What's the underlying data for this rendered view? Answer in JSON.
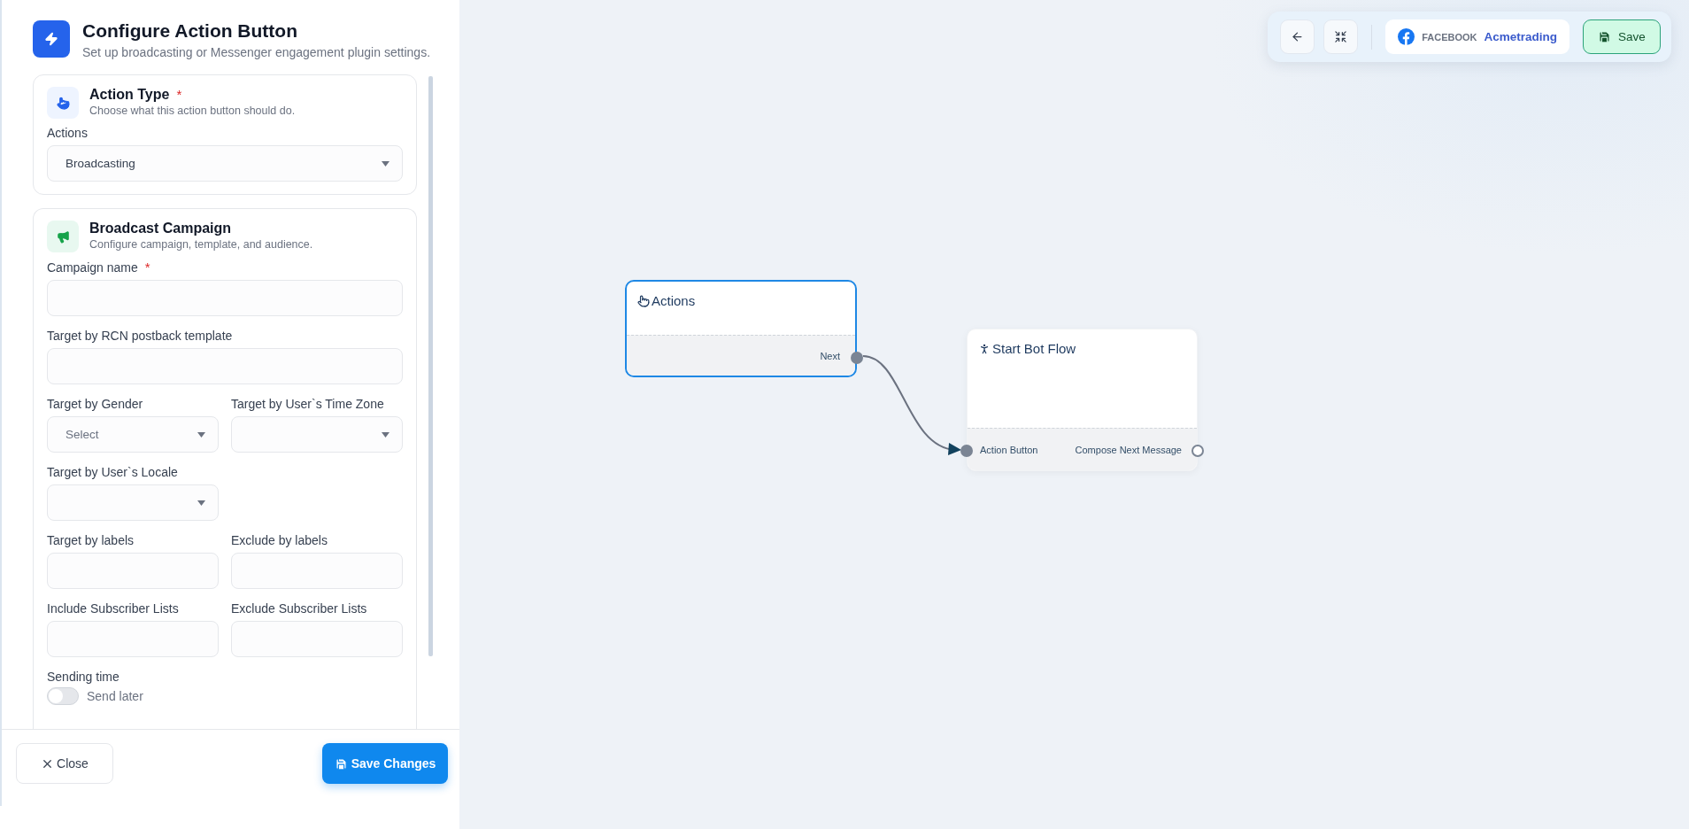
{
  "panel": {
    "title": "Configure Action Button",
    "subtitle": "Set up broadcasting or Messenger engagement plugin settings.",
    "sections": [
      {
        "kind": "action",
        "title": "Action Type",
        "mark": "*",
        "subtitle": "Choose what this action button should do.",
        "rows": [
          [
            {
              "kind": "select",
              "label": "Actions",
              "value": "Broadcasting"
            }
          ]
        ]
      },
      {
        "kind": "broadcast",
        "title": "Broadcast Campaign",
        "subtitle": "Configure campaign, template, and audience.",
        "rows": [
          [
            {
              "kind": "text",
              "label": "Campaign name",
              "mark": "*"
            }
          ],
          [
            {
              "kind": "text",
              "label": "Target by RCN postback template"
            }
          ],
          [
            {
              "kind": "select",
              "label": "Target by Gender",
              "placeholder": "Select"
            },
            {
              "kind": "select",
              "label": "Target by User`s Time Zone"
            }
          ],
          [
            {
              "kind": "select",
              "label": "Target by User`s Locale"
            }
          ],
          [
            {
              "kind": "text",
              "label": "Target by labels"
            },
            {
              "kind": "text",
              "label": "Exclude by labels"
            }
          ],
          [
            {
              "kind": "text",
              "label": "Include Subscriber Lists"
            },
            {
              "kind": "text",
              "label": "Exclude Subscriber Lists"
            }
          ],
          [
            {
              "kind": "toggle",
              "label": "Sending time",
              "option": "Send later",
              "on": false
            }
          ]
        ]
      }
    ],
    "footer": {
      "close": "Close",
      "save": "Save Changes"
    }
  },
  "toolbar": {
    "platform": "FACEBOOK",
    "account": "Acmetrading",
    "save": "Save"
  },
  "canvas": {
    "nodes": [
      {
        "kind": "actions",
        "title": "Actions",
        "selected": true,
        "output": {
          "label": "Next",
          "connected": true
        }
      },
      {
        "kind": "bot",
        "title": "Start Bot Flow",
        "selected": false,
        "input": {
          "label": "Action Button",
          "connected": true
        },
        "output": {
          "label": "Compose Next Message",
          "connected": false
        }
      }
    ]
  }
}
